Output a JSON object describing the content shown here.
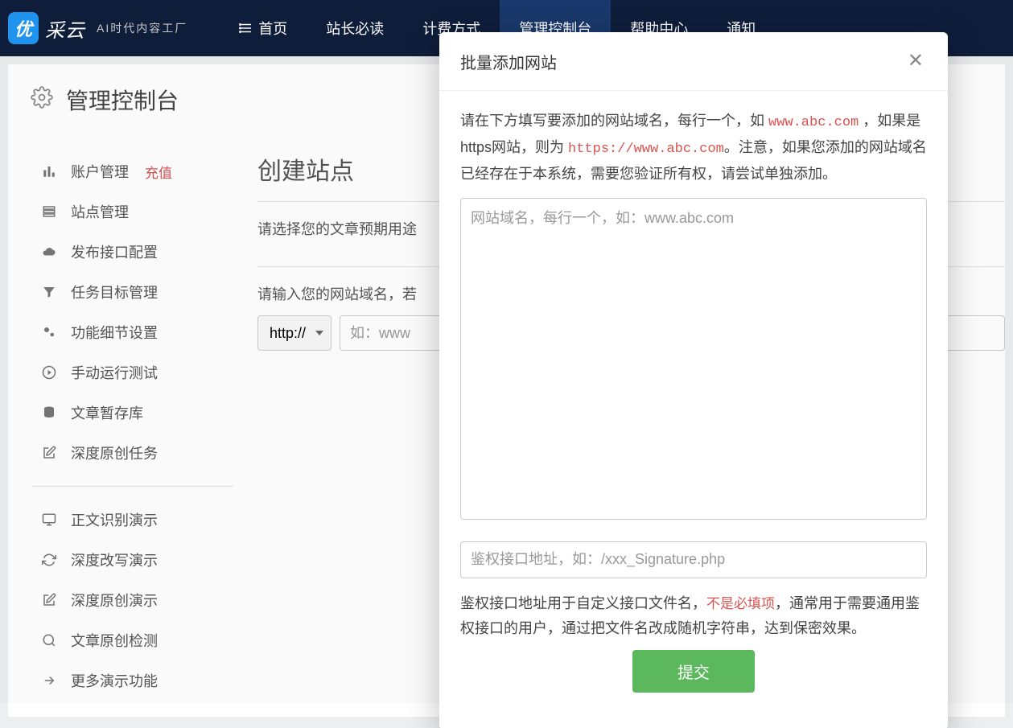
{
  "logo": {
    "badge": "优",
    "text": "采云",
    "sub": "AI时代内容工厂"
  },
  "nav": [
    {
      "label": "首页",
      "icon": "list"
    },
    {
      "label": "站长必读"
    },
    {
      "label": "计费方式"
    },
    {
      "label": "管理控制台",
      "active": true
    },
    {
      "label": "帮助中心"
    },
    {
      "label": "通知"
    }
  ],
  "page_title": "管理控制台",
  "sidebar": {
    "items": [
      {
        "label": "账户管理",
        "icon": "chart",
        "badge": "充值"
      },
      {
        "label": "站点管理",
        "icon": "list"
      },
      {
        "label": "发布接口配置",
        "icon": "cloud"
      },
      {
        "label": "任务目标管理",
        "icon": "filter"
      },
      {
        "label": "功能细节设置",
        "icon": "cogs"
      },
      {
        "label": "手动运行测试",
        "icon": "play"
      },
      {
        "label": "文章暂存库",
        "icon": "db"
      },
      {
        "label": "深度原创任务",
        "icon": "edit"
      }
    ],
    "items2": [
      {
        "label": "正文识别演示",
        "icon": "monitor"
      },
      {
        "label": "深度改写演示",
        "icon": "refresh"
      },
      {
        "label": "深度原创演示",
        "icon": "edit"
      },
      {
        "label": "文章原创检测",
        "icon": "search"
      },
      {
        "label": "更多演示功能",
        "icon": "share"
      }
    ]
  },
  "main": {
    "title": "创建站点",
    "purpose_label": "请选择您的文章预期用途",
    "domain_label": "请输入您的网站域名，若",
    "protocol_value": "http://",
    "domain_placeholder": "如：www"
  },
  "modal": {
    "title": "批量添加网站",
    "desc_p1": "请在下方填写要添加的网站域名，每行一个，如 ",
    "desc_c1": "www.abc.com",
    "desc_p2": " ，如果是https网站，则为 ",
    "desc_c2": "https://www.abc.com",
    "desc_p3": "。注意，如果您添加的网站域名已经存在于本系统，需要您验证所有权，请尝试单独添加。",
    "textarea_placeholder": "网站域名，每行一个，如：www.abc.com",
    "auth_placeholder": "鉴权接口地址，如：/xxx_Signature.php",
    "auth_desc_p1": "鉴权接口地址用于自定义接口文件名，",
    "auth_note": "不是必填项",
    "auth_desc_p2": "，通常用于需要通用鉴权接口的用户，通过把文件名改成随机字符串，达到保密效果。",
    "submit": "提交"
  }
}
